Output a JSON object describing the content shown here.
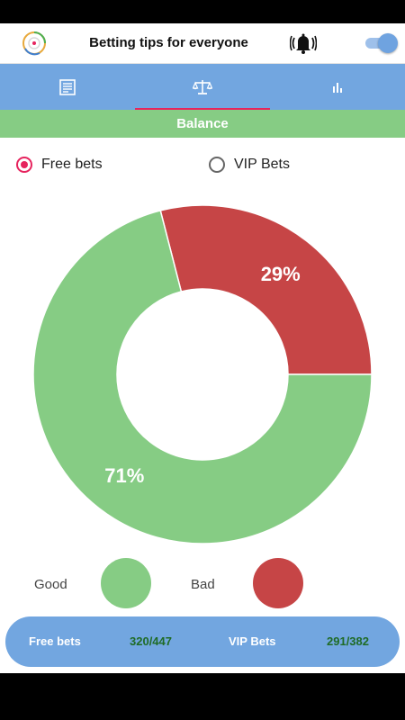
{
  "header": {
    "title": "Betting tips for everyone"
  },
  "tabs": [
    {
      "name": "document-icon",
      "active": false
    },
    {
      "name": "balance-scale-icon",
      "active": true
    },
    {
      "name": "bar-chart-icon",
      "active": false
    }
  ],
  "banner": {
    "label": "Balance"
  },
  "radios": {
    "free_label": "Free bets",
    "vip_label": "VIP Bets",
    "selected": "Free bets"
  },
  "chart_data": {
    "type": "pie",
    "categories": [
      "Good",
      "Bad"
    ],
    "values": [
      71,
      29
    ],
    "labels": [
      "71%",
      "29%"
    ],
    "colors": [
      "#86cc84",
      "#c64546"
    ]
  },
  "legend": {
    "good_label": "Good",
    "bad_label": "Bad",
    "good_color": "#86cc84",
    "bad_color": "#c64546"
  },
  "stats": {
    "free_label": "Free bets",
    "free_value": "320/447",
    "vip_label": "VIP Bets",
    "vip_value": "291/382"
  },
  "colors": {
    "accent": "#e6245e",
    "tab_bar": "#72a6e0",
    "banner": "#86cc84"
  }
}
